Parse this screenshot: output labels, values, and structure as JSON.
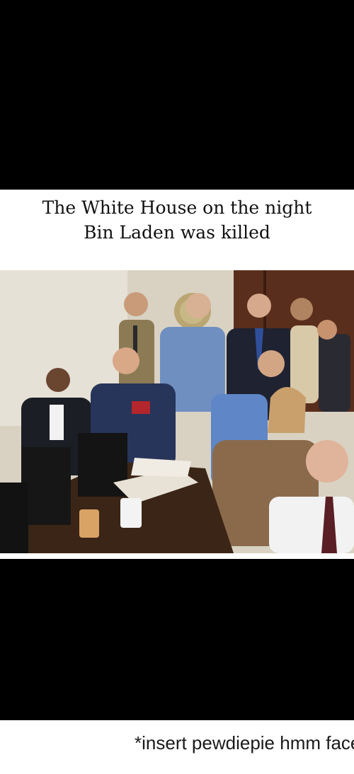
{
  "meme": {
    "caption_line1": "The White House on the night",
    "caption_line2": "Bin Laden was killed"
  },
  "footer": {
    "text": "*insert pewdiepie hmm face"
  },
  "colors": {
    "background": "#000000",
    "card": "#ffffff",
    "caption_text": "#111111",
    "footer_text": "#1a1a1a"
  }
}
